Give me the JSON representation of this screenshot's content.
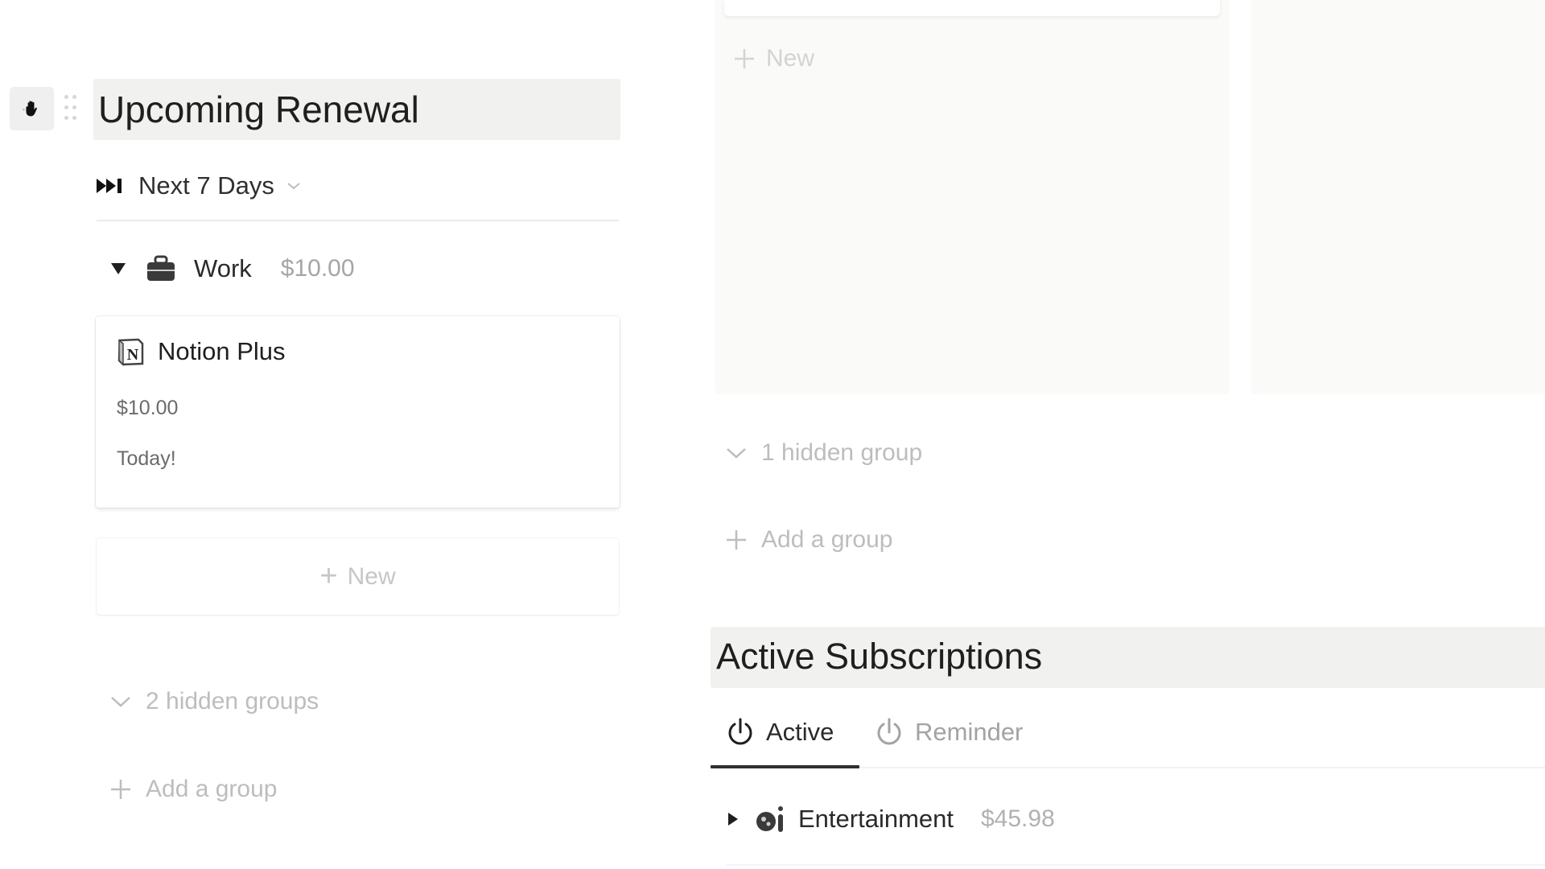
{
  "upcoming_renewal": {
    "title": "Upcoming Renewal",
    "view": {
      "label": "Next 7 Days",
      "icon": "fast-forward-icon"
    },
    "groups": [
      {
        "name": "Work",
        "icon": "briefcase-icon",
        "sum": "$10.00",
        "expanded": true,
        "cards": [
          {
            "title": "Notion Plus",
            "icon": "notion-logo-icon",
            "price": "$10.00",
            "due": "Today!"
          }
        ]
      }
    ],
    "new_label": "New",
    "hidden_groups_label": "2 hidden groups",
    "add_group_label": "Add a group"
  },
  "right_board": {
    "new_label": "New",
    "hidden_groups_label": "1 hidden group",
    "add_group_label": "Add a group"
  },
  "active_subscriptions": {
    "title": "Active Subscriptions",
    "tabs": [
      {
        "label": "Active",
        "icon": "power-icon",
        "selected": true
      },
      {
        "label": "Reminder",
        "icon": "power-icon",
        "selected": false
      }
    ],
    "groups": [
      {
        "name": "Entertainment",
        "icon": "entertainment-icon",
        "sum": "$45.98",
        "expanded": false
      }
    ]
  },
  "colors": {
    "title_bg": "#f1f1ef",
    "text_primary": "#1f1f1f",
    "text_muted": "#bdbdbb",
    "column_bg": "#fafaf9",
    "tab_underline": "#2f2f2f"
  }
}
